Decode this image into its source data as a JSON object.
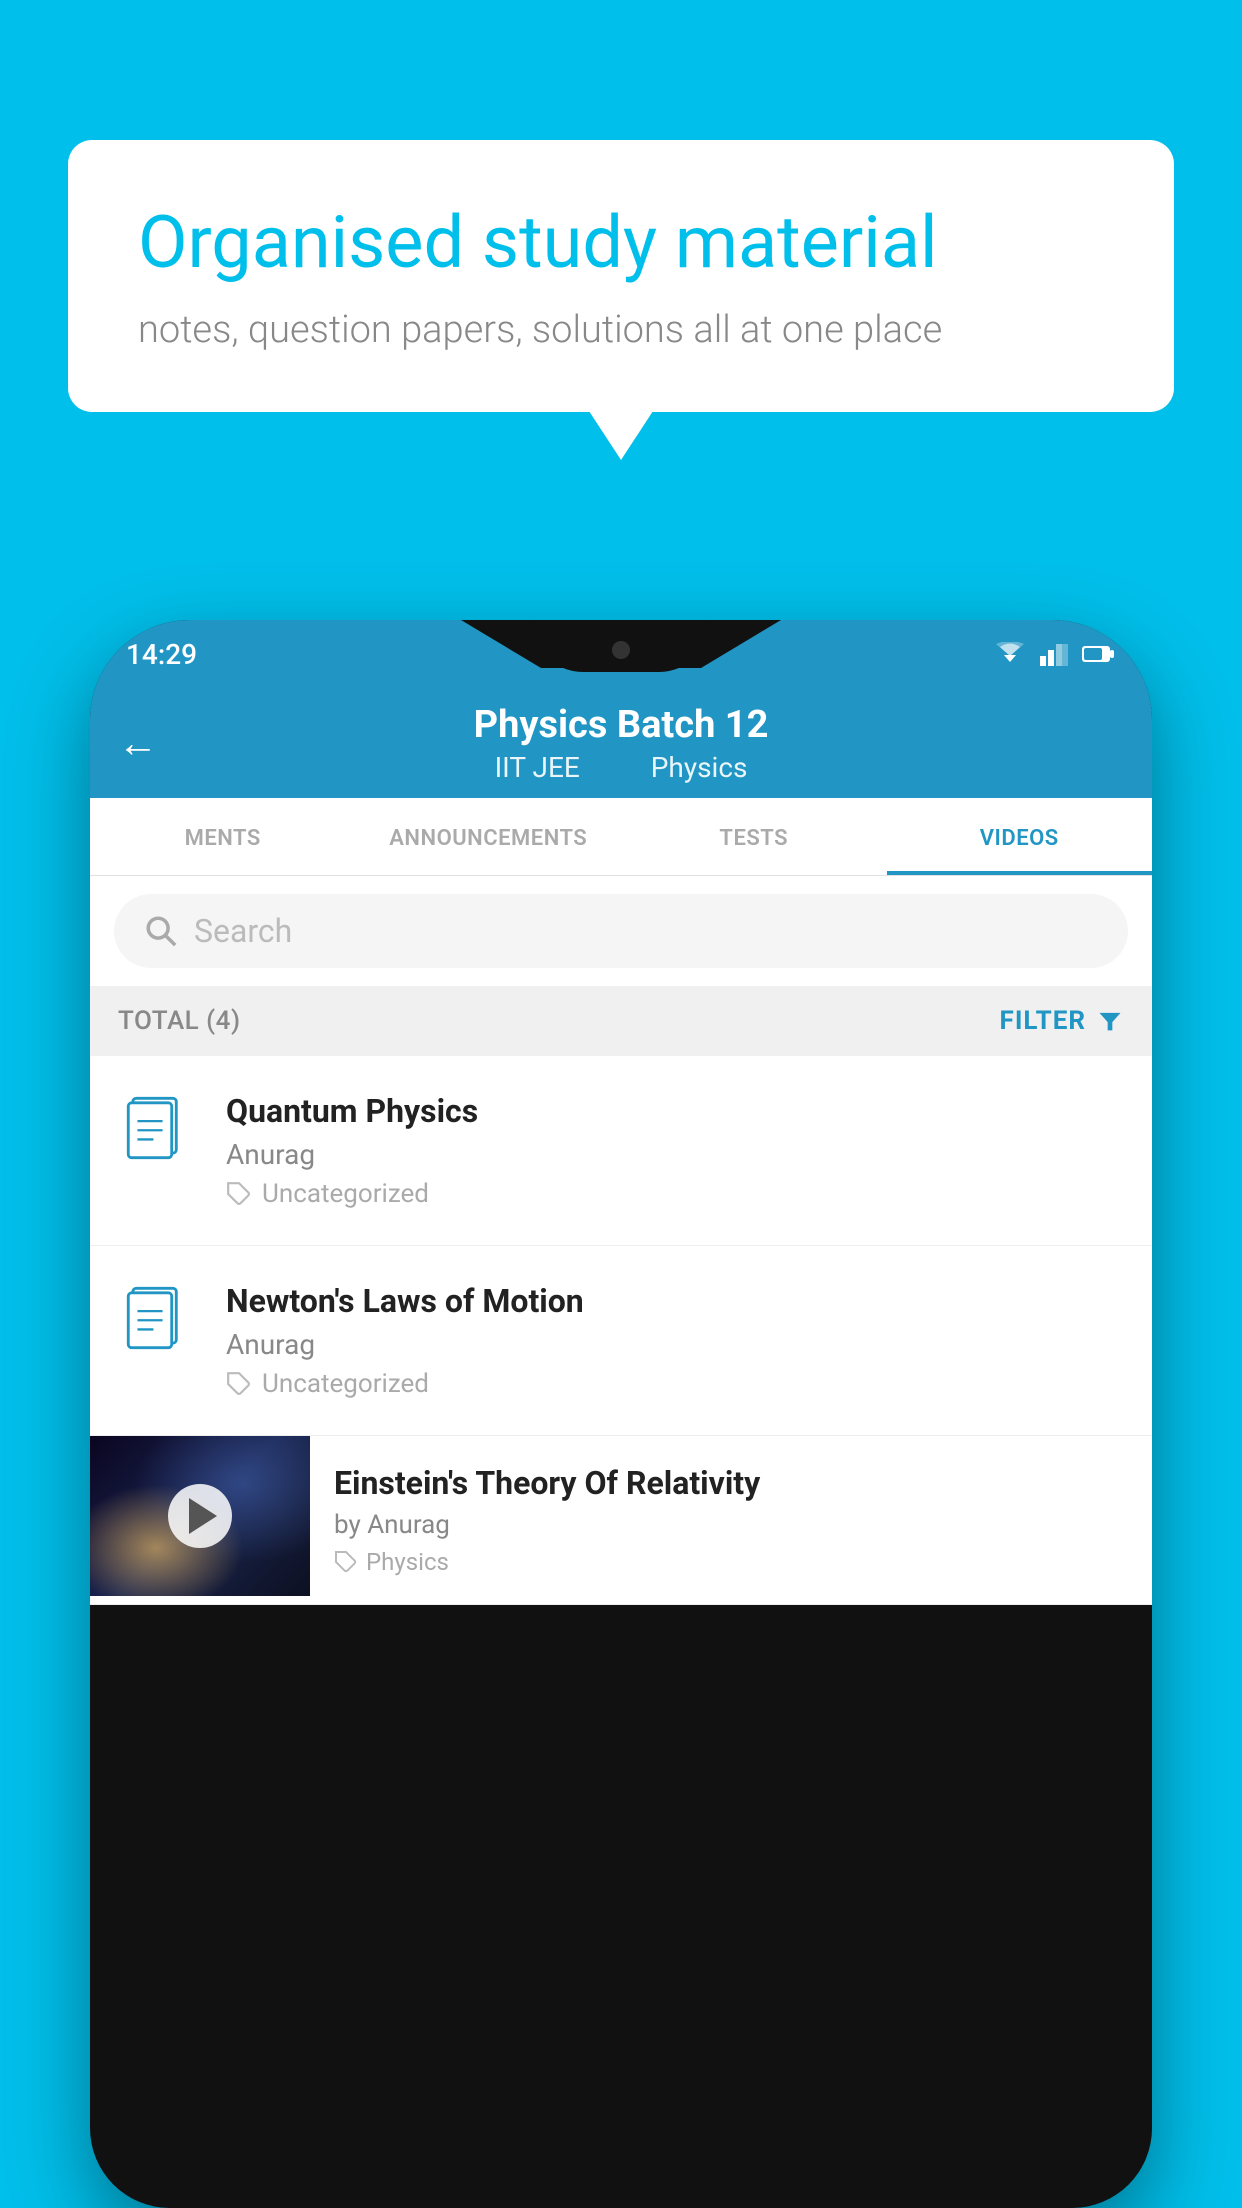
{
  "background_color": "#00BFEA",
  "speech_bubble": {
    "title": "Organised study material",
    "subtitle": "notes, question papers, solutions all at one place"
  },
  "status_bar": {
    "time": "14:29"
  },
  "header": {
    "title": "Physics Batch 12",
    "subtitle_part1": "IIT JEE",
    "subtitle_part2": "Physics",
    "back_label": "←"
  },
  "tabs": [
    {
      "label": "MENTS",
      "active": false
    },
    {
      "label": "ANNOUNCEMENTS",
      "active": false
    },
    {
      "label": "TESTS",
      "active": false
    },
    {
      "label": "VIDEOS",
      "active": true
    }
  ],
  "search": {
    "placeholder": "Search"
  },
  "filter_bar": {
    "total_label": "TOTAL (4)",
    "filter_label": "FILTER"
  },
  "videos": [
    {
      "title": "Quantum Physics",
      "author": "Anurag",
      "tag": "Uncategorized",
      "has_thumbnail": false
    },
    {
      "title": "Newton's Laws of Motion",
      "author": "Anurag",
      "tag": "Uncategorized",
      "has_thumbnail": false
    },
    {
      "title": "Einstein's Theory Of Relativity",
      "author": "by Anurag",
      "tag": "Physics",
      "has_thumbnail": true
    }
  ]
}
